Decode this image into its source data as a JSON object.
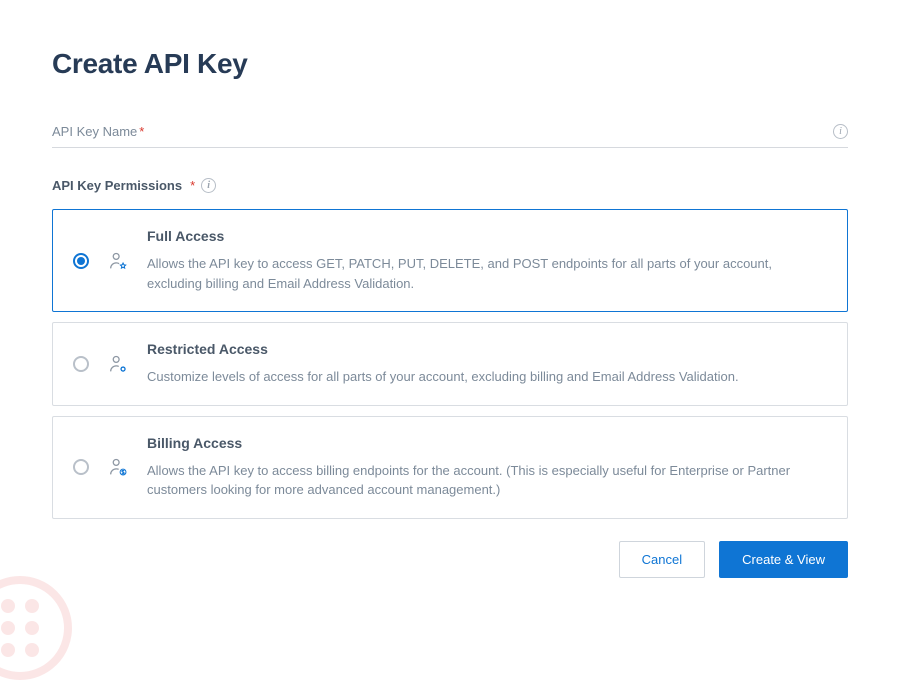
{
  "title": "Create API Key",
  "nameField": {
    "label": "API Key Name",
    "value": "",
    "placeholder": ""
  },
  "permissions": {
    "label": "API Key Permissions",
    "options": [
      {
        "key": "full",
        "title": "Full Access",
        "desc": "Allows the API key to access GET, PATCH, PUT, DELETE, and POST endpoints for all parts of your account, excluding billing and Email Address Validation.",
        "selected": true,
        "icon": "user-star-icon"
      },
      {
        "key": "restricted",
        "title": "Restricted Access",
        "desc": "Customize levels of access for all parts of your account, excluding billing and Email Address Validation.",
        "selected": false,
        "icon": "user-gear-icon"
      },
      {
        "key": "billing",
        "title": "Billing Access",
        "desc": "Allows the API key to access billing endpoints for the account. (This is especially useful for Enterprise or Partner customers looking for more advanced account management.)",
        "selected": false,
        "icon": "user-dollar-icon"
      }
    ]
  },
  "buttons": {
    "cancel": "Cancel",
    "submit": "Create & View"
  }
}
